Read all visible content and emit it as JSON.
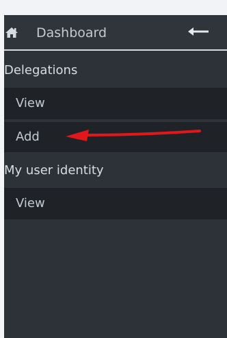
{
  "header": {
    "title": "Dashboard",
    "home_icon": "home-icon",
    "back_icon": "arrow-left-icon"
  },
  "sidebar": {
    "sections": [
      {
        "title": "Delegations",
        "items": [
          {
            "label": "View"
          },
          {
            "label": "Add"
          }
        ]
      },
      {
        "title": "My user identity",
        "items": [
          {
            "label": "View"
          }
        ]
      }
    ]
  },
  "annotation": {
    "type": "red-arrow",
    "color": "#e0181b",
    "points_to": "Add"
  },
  "colors": {
    "sidebar_bg": "#2d3238",
    "item_bg": "#1f2327",
    "text": "#c4cad0",
    "section_text": "#d8dde2"
  }
}
